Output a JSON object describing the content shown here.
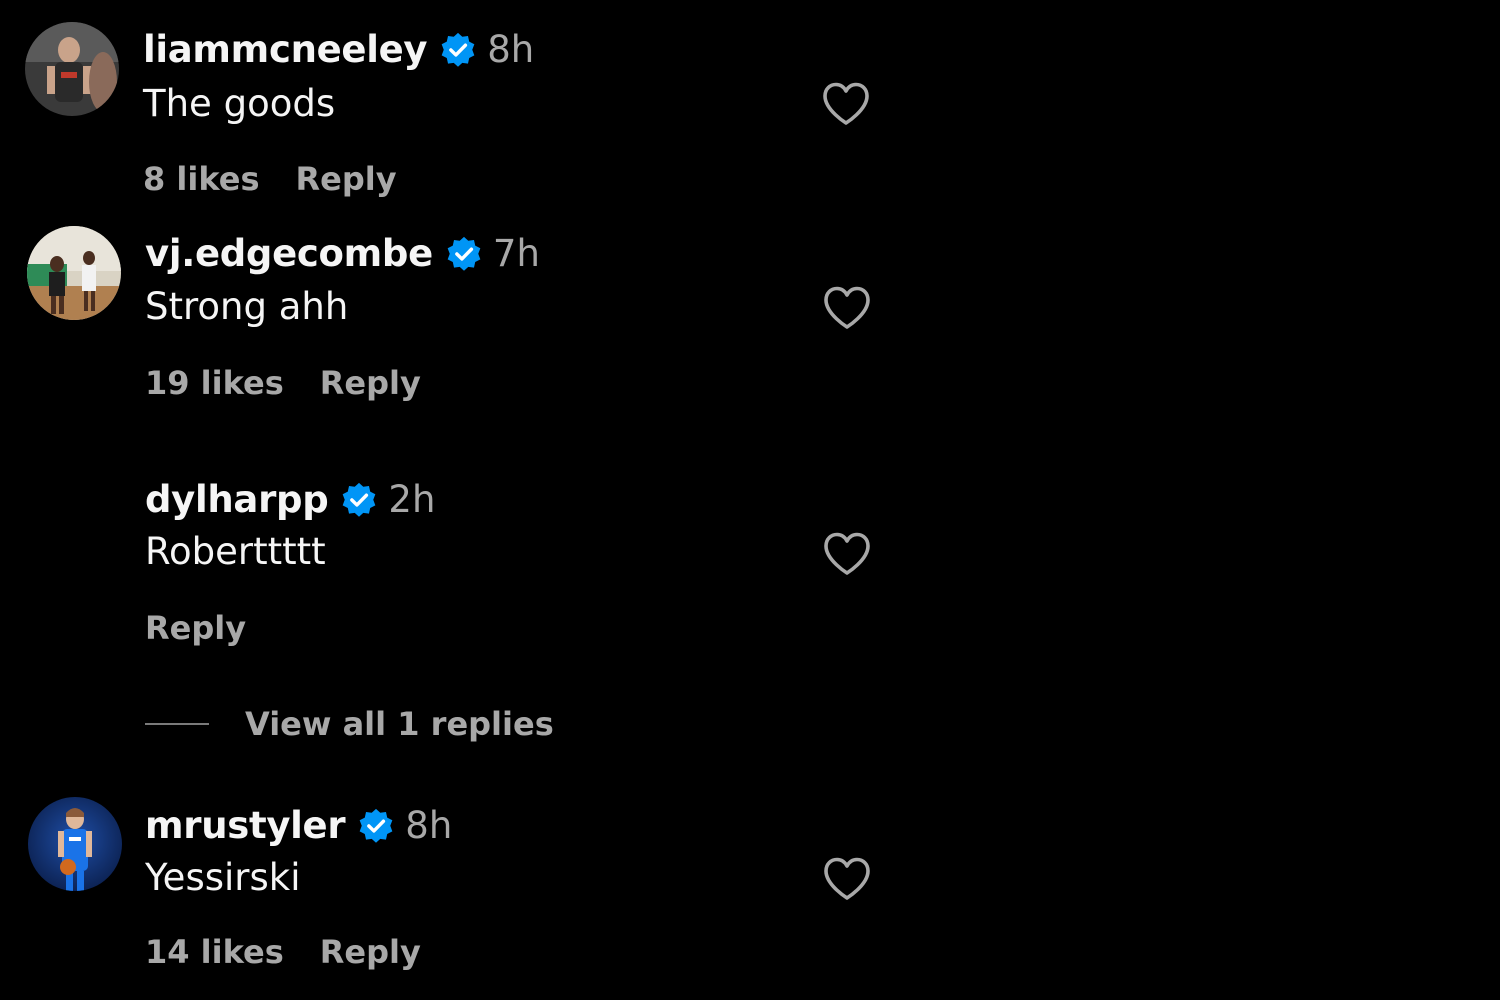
{
  "comments": [
    {
      "username": "liammcneeley",
      "verified_icon": "verified-badge-icon",
      "time": "8h",
      "text": "The goods",
      "likes": "8 likes",
      "reply": "Reply"
    },
    {
      "username": "vj.edgecombe",
      "verified_icon": "verified-badge-icon",
      "time": "7h",
      "text": "Strong ahh",
      "likes": "19 likes",
      "reply": "Reply"
    },
    {
      "username": "dylharpp",
      "verified_icon": "verified-badge-icon",
      "time": "2h",
      "text": "Roberttttt",
      "reply": "Reply",
      "view_replies": "View all 1 replies"
    },
    {
      "username": "mrustyler",
      "verified_icon": "verified-badge-icon",
      "time": "8h",
      "text": "Yessirski",
      "likes": "14 likes",
      "reply": "Reply"
    }
  ],
  "icons": {
    "heart": "heart-outline-icon",
    "verified": "verified-badge-icon"
  },
  "colors": {
    "background": "#000000",
    "primary_text": "#f5f5f5",
    "secondary_text": "#a8a8a8",
    "verified_blue": "#0095f6"
  }
}
